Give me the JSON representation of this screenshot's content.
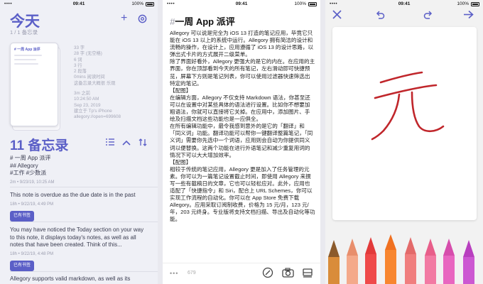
{
  "status": {
    "signal": "••••",
    "time": "09:41",
    "battery": "100%"
  },
  "list": {
    "title": "今天",
    "subtitle": "1 / 1 备忘录",
    "card_title": "# 一周 App 派评",
    "meta": [
      "33 字",
      "28 字 (无空格)",
      "6 词",
      "3 行",
      "2 段落",
      "0mins 阅读时间",
      "这备忘录大概很 乐观"
    ],
    "meta2": [
      "3m 之前",
      "10:24:50 AM",
      "Sep 23, 2019",
      "建立于 Tp's iPhone",
      "allegory://open=699608"
    ],
    "count_title": "11 备忘录",
    "first_note": [
      "# 一周 App 派评",
      "## Allegory",
      "#工作 #少数派"
    ],
    "first_ts": "2m • 9/23/19, 10:25 AM",
    "note2": "This note is overdue as the due date is in the past",
    "note2_ts": "18h • 9/22/19, 4:49 PM",
    "badge": "已有书签",
    "note3": "You may have noticed the Today section on your way to this note, it displays today's notes, as well as all notes that have been created. Think of this...",
    "note3_ts": "18h • 9/22/19, 4:48 PM",
    "badge2": "已有书签",
    "note4": "Allegory supports valid markdown, as well as its"
  },
  "editor": {
    "heading_hash": "#",
    "heading": "一周 App 派评",
    "paragraphs": [
      "Allegory 可以说是完全为 iOS 13 打造的笔记应用，毕竟它只能在 iOS 13 以上的系统中运行。Allegory 拥有简洁的设计和流畅的操作，在设计上，应用遵循了 iOS 13 的设计思路，以弹出式卡片的方式展开二级菜单。",
      "除了界面好看外，Allegory 更强大的是它的内在。在应用的主界面，你在顶部看到今天的所有笔记，左右滑动即可快捷预览，屏幕下方则是笔记列表，你可以使用过滤器快速筛选出特定的笔记。",
      "【配图】",
      "在编辑方面，Allegory 不仅支持 Markdown 语法，你甚至还可以在设置中对某些具体的语法进行设置。比如你不想要加粗语法，你就可以直接将它关掉。在应用中，添加图片、手绘及扫描文档这些功能也是一应俱全。",
      "在所有编辑功能中，最令我感到意外的是它的「翻译」和「同义词」功能。翻译功能可以帮你一键翻译整篇笔记，「同义词」需要你先选中一个词语，应用则会自动为你提供同义词以便替换。这两个功能在进行外语笔记和减少重复用词的情况下可以大大增加效率。",
      "【配图】",
      "相较于传统的笔记应用，Allegory 更是加入了任务管理的元素。你可以为一篇笔记设置截止时间，即使用 Allegory 来撰写一些有截稿日的文章，它也可以轻松应对。此外，应用也适配了「快捷指令」和 Siri，配合上 URL Schemes，你可以实现工作流程的自动化。你可以在 App Store 免费下载 Allegory。应用采取订阅制收费，价格为 15 元/月，123 元/年，203 元终身。专业版将支持文档扫描、导出及自动化等功能。"
    ],
    "dots": "•••",
    "char_count": "679"
  },
  "drawing": {},
  "colors": {
    "accent": "#5b5fc7",
    "stroke": "#c0262b"
  }
}
